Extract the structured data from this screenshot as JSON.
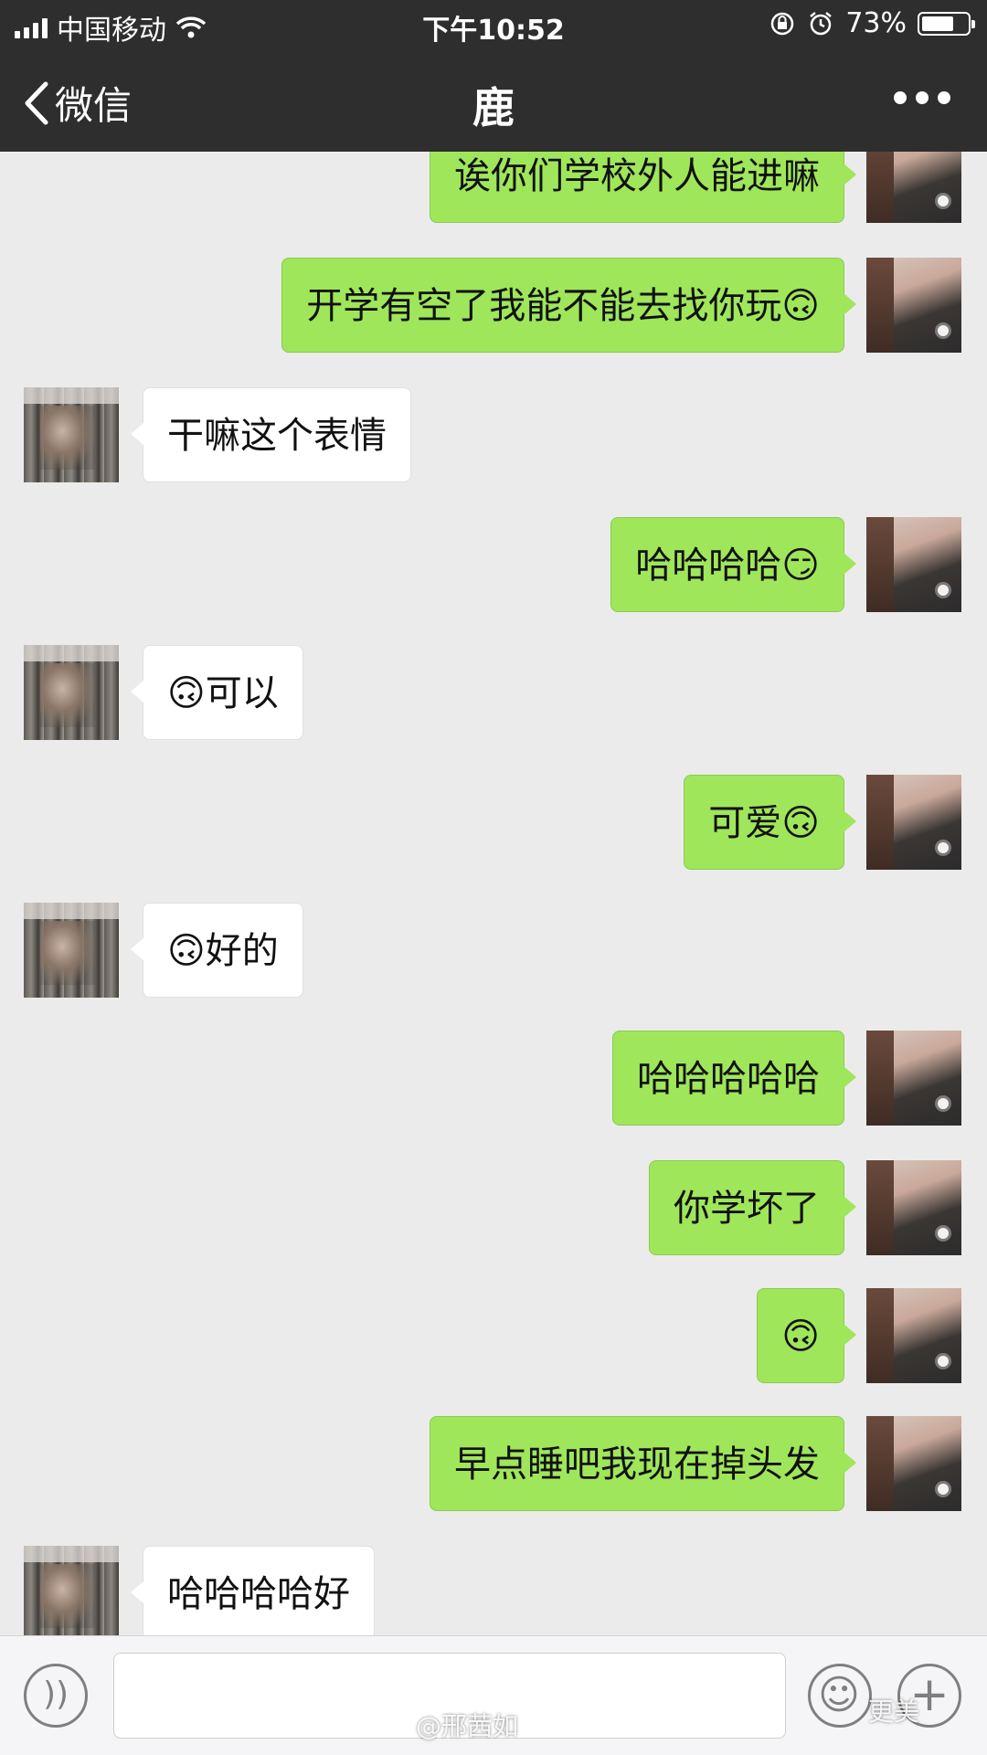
{
  "status_bar": {
    "carrier": "中国移动",
    "time": "下午10:52",
    "battery_text": "73%",
    "battery_level": 0.73
  },
  "nav": {
    "back_label": "微信",
    "title": "鹿"
  },
  "messages": [
    {
      "sender": "me",
      "text": "诶你们学校外人能进嘛"
    },
    {
      "sender": "me",
      "text": "开学有空了我能不能去找你玩🙃"
    },
    {
      "sender": "peer",
      "text": "干嘛这个表情"
    },
    {
      "sender": "me",
      "text": "哈哈哈哈😏"
    },
    {
      "sender": "peer",
      "text": "🙃可以"
    },
    {
      "sender": "me",
      "text": "可爱🙃"
    },
    {
      "sender": "peer",
      "text": "🙃好的"
    },
    {
      "sender": "me",
      "text": "哈哈哈哈哈"
    },
    {
      "sender": "me",
      "text": "你学坏了"
    },
    {
      "sender": "me",
      "text": "🙃"
    },
    {
      "sender": "me",
      "text": "早点睡吧我现在掉头发"
    },
    {
      "sender": "peer",
      "text": "哈哈哈哈好"
    }
  ],
  "input_bar": {
    "voice_icon": "voice-icon",
    "emoji_icon": "emoji-icon",
    "plus_icon": "plus-icon"
  },
  "watermarks": {
    "weibo": "@邢茜如",
    "brand": "更美"
  }
}
